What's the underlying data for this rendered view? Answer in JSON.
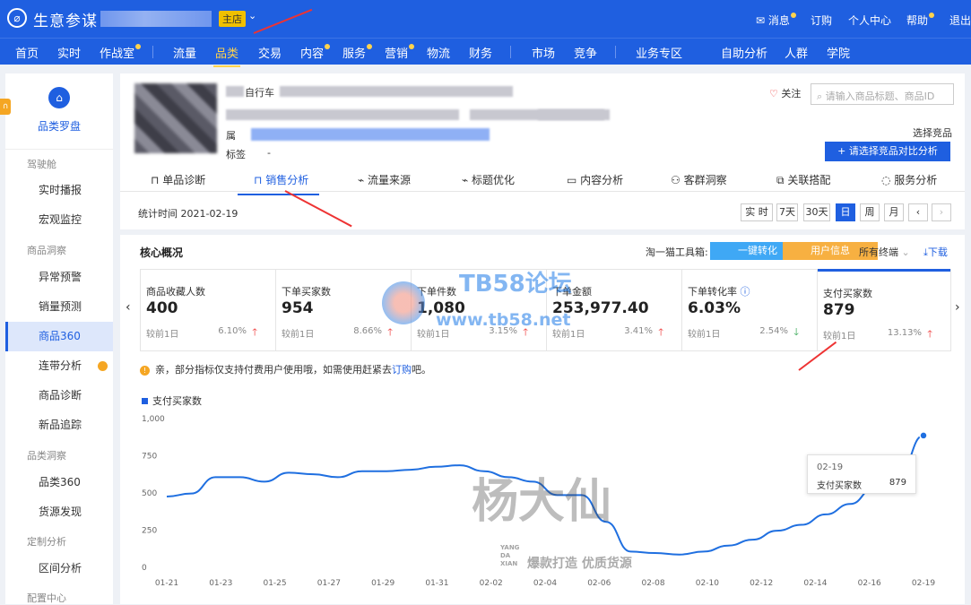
{
  "topbar": {
    "brand": "生意参谋",
    "shop_badge": "主店",
    "links": [
      "消息",
      "订购",
      "个人中心",
      "帮助",
      "退出"
    ]
  },
  "nav": [
    "首页",
    "实时",
    "作战室",
    "流量",
    "品类",
    "交易",
    "内容",
    "服务",
    "营销",
    "物流",
    "财务",
    "市场",
    "竞争",
    "业务专区",
    "自助分析",
    "人群",
    "学院"
  ],
  "sidebar": {
    "title": "品类罗盘",
    "sections": [
      {
        "label": "驾驶舱",
        "items": [
          "实时播报",
          "宏观监控"
        ]
      },
      {
        "label": "商品洞察",
        "items": [
          "异常预警",
          "销量预测",
          "商品360",
          "连带分析",
          "商品诊断",
          "新品追踪"
        ]
      },
      {
        "label": "品类洞察",
        "items": [
          "品类360",
          "货源发现"
        ]
      },
      {
        "label": "定制分析",
        "items": [
          "区间分析"
        ]
      },
      {
        "label": "配置中心",
        "items": []
      }
    ]
  },
  "product": {
    "name": "自行车",
    "attr_label": "属",
    "tag_label": "标签",
    "tag_value": "-",
    "follow": "关注",
    "search_placeholder": "请输入商品标题、商品ID",
    "compare_label": "选择竞品",
    "compare_button": "+ 请选择竞品对比分析"
  },
  "tabs": [
    "单品诊断",
    "销售分析",
    "流量来源",
    "标题优化",
    "内容分析",
    "客群洞察",
    "关联搭配",
    "服务分析"
  ],
  "time": {
    "stat_label": "统计时间 2021-02-19",
    "buttons": [
      "实 时",
      "7天",
      "30天",
      "日",
      "周",
      "月",
      "‹",
      "›"
    ]
  },
  "core": {
    "title": "核心概况",
    "toolbox_label": "淘一猫工具箱:",
    "btn1": "一键转化",
    "btn2": "用户信息",
    "terminal": "所有终端",
    "download": "下载"
  },
  "kpis": [
    {
      "name": "商品收藏人数",
      "value": "400",
      "cmp": "较前1日",
      "pct": "6.10%",
      "dir": "up"
    },
    {
      "name": "下单买家数",
      "value": "954",
      "cmp": "较前1日",
      "pct": "8.66%",
      "dir": "up"
    },
    {
      "name": "下单件数",
      "value": "1,080",
      "cmp": "较前1日",
      "pct": "3.15%",
      "dir": "up"
    },
    {
      "name": "下单金额",
      "value": "253,977.40",
      "cmp": "较前1日",
      "pct": "3.41%",
      "dir": "up"
    },
    {
      "name": "下单转化率",
      "value": "6.03%",
      "cmp": "较前1日",
      "pct": "2.54%",
      "dir": "down"
    },
    {
      "name": "支付买家数",
      "value": "879",
      "cmp": "较前1日",
      "pct": "13.13%",
      "dir": "up"
    }
  ],
  "notice": {
    "text": "亲，部分指标仅支持付费用户使用哦，如需使用赶紧去",
    "link": "订购",
    "tail": "吧。"
  },
  "tooltip": {
    "date": "02-19",
    "name": "支付买家数",
    "value": "879"
  },
  "watermark": {
    "tb58": "TB58论坛",
    "url": "www.tb58.net",
    "sig": "杨大仙",
    "sig_small": [
      "YANG",
      "DA",
      "XIAN"
    ],
    "slogan": "爆款打造 优质货源"
  },
  "chart_data": {
    "type": "line",
    "series": [
      {
        "name": "支付买家数",
        "values": [
          470,
          490,
          600,
          600,
          570,
          630,
          620,
          600,
          640,
          640,
          650,
          670,
          680,
          640,
          600,
          570,
          480,
          480,
          300,
          100,
          90,
          80,
          100,
          140,
          180,
          240,
          280,
          350,
          420,
          530,
          620,
          880
        ]
      }
    ],
    "x": [
      "01-21",
      "01-22",
      "01-23",
      "01-24",
      "01-25",
      "01-26",
      "01-27",
      "01-28",
      "01-29",
      "01-30",
      "01-31",
      "02-01",
      "02-02",
      "02-03",
      "02-04",
      "02-05",
      "02-06",
      "02-07",
      "02-08",
      "02-09",
      "02-10",
      "02-11",
      "02-12",
      "02-13",
      "02-14",
      "02-15",
      "02-16",
      "02-17",
      "02-18",
      "",
      "",
      "02-19"
    ],
    "xticks": [
      "01-21",
      "01-23",
      "01-25",
      "01-27",
      "01-29",
      "01-31",
      "02-02",
      "02-04",
      "02-06",
      "02-08",
      "02-10",
      "02-12",
      "02-14",
      "02-16",
      "02-19"
    ],
    "yticks": [
      "1,000",
      "750",
      "500",
      "250",
      "0"
    ],
    "ylim": [
      0,
      1000
    ],
    "legend": "top-left",
    "grid": false
  }
}
